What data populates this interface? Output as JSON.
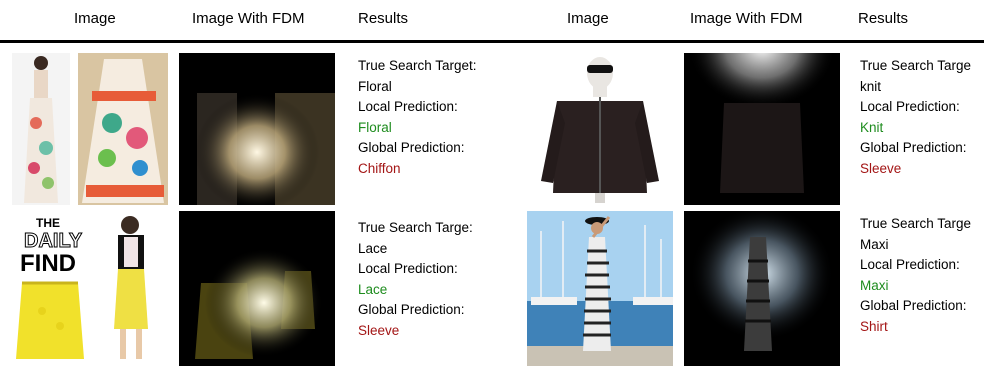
{
  "headers": [
    "Image",
    "Image With FDM",
    "Results",
    "Image",
    "Image With FDM",
    "Results"
  ],
  "results": [
    {
      "true_label": "True Search Target:",
      "true_value": "Floral",
      "local_label": "Local Prediction:",
      "local_value": "Floral",
      "global_label": "Global Prediction:",
      "global_value": "Chiffon"
    },
    {
      "true_label": "True Search Targe",
      "true_value": "knit",
      "local_label": "Local Prediction:",
      "local_value": "Knit",
      "global_label": "Global Prediction:",
      "global_value": "Sleeve"
    },
    {
      "true_label": "True Search Targe:",
      "true_value": "Lace",
      "local_label": "Local Prediction:",
      "local_value": "Lace",
      "global_label": "Global Prediction:",
      "global_value": "Sleeve"
    },
    {
      "true_label": "True Search Targe",
      "true_value": "Maxi",
      "local_label": "Local Prediction:",
      "local_value": "Maxi",
      "global_label": "Global Prediction:",
      "global_value": "Shirt"
    }
  ],
  "logo": {
    "line1": "THE",
    "line2": "DAILY",
    "line3": "FIND"
  },
  "colors": {
    "correct": "#1e8c1e",
    "wrong": "#a31515"
  }
}
